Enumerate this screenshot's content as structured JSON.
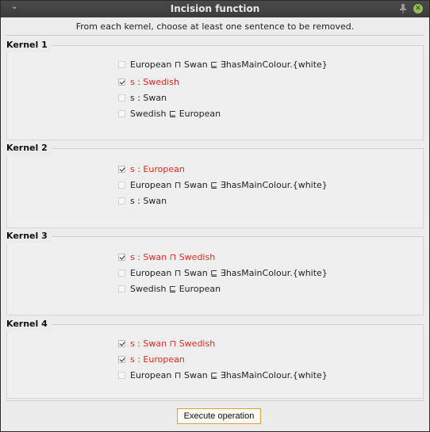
{
  "window": {
    "title": "Incision function"
  },
  "instruction": "From each kernel, choose at least one sentence to be removed.",
  "kernels": [
    {
      "label": "Kernel 1",
      "options": [
        {
          "text": "European ⊓ Swan ⊑ ∃hasMainColour.{white}",
          "checked": false
        },
        {
          "text": "s : Swedish",
          "checked": true
        },
        {
          "text": "s : Swan",
          "checked": false
        },
        {
          "text": "Swedish ⊑ European",
          "checked": false
        }
      ]
    },
    {
      "label": "Kernel 2",
      "options": [
        {
          "text": "s : European",
          "checked": true
        },
        {
          "text": "European ⊓ Swan ⊑ ∃hasMainColour.{white}",
          "checked": false
        },
        {
          "text": "s : Swan",
          "checked": false
        }
      ]
    },
    {
      "label": "Kernel 3",
      "options": [
        {
          "text": "s : Swan ⊓ Swedish",
          "checked": true
        },
        {
          "text": "European ⊓ Swan ⊑ ∃hasMainColour.{white}",
          "checked": false
        },
        {
          "text": "Swedish ⊑ European",
          "checked": false
        }
      ]
    },
    {
      "label": "Kernel 4",
      "options": [
        {
          "text": "s : Swan ⊓ Swedish",
          "checked": true
        },
        {
          "text": "s : European",
          "checked": true
        },
        {
          "text": "European ⊓ Swan ⊑ ∃hasMainColour.{white}",
          "checked": false
        }
      ]
    }
  ],
  "execute_button": "Execute operation",
  "colors": {
    "selected_text": "#e8261f",
    "button_border": "#e0a240"
  }
}
